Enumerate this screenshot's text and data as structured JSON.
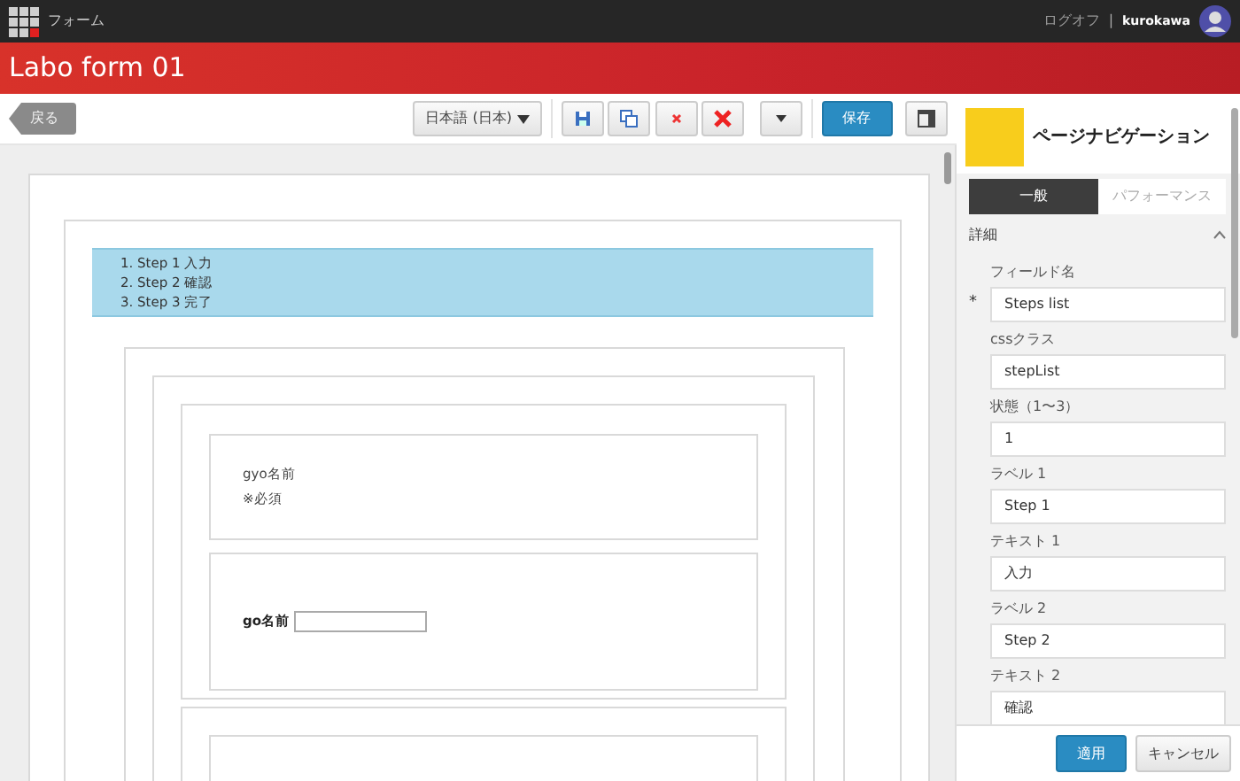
{
  "app": {
    "title": "フォーム",
    "logoff": "ログオフ",
    "separator": "|",
    "user": "kurokawa"
  },
  "header": {
    "title": "Labo form 01"
  },
  "toolbar": {
    "back": "戻る",
    "language": "日本語 (日本)",
    "save": "保存"
  },
  "canvas": {
    "steps": [
      "1. Step 1 入力",
      "2. Step 2 確認",
      "3. Step 3 完了"
    ],
    "cards": [
      {
        "kind": "text",
        "lines": [
          "gyo名前",
          "※必須"
        ]
      },
      {
        "kind": "input",
        "label": "go名前"
      },
      {
        "kind": "empty"
      }
    ]
  },
  "panel": {
    "title": "ページナビゲーション",
    "tabs": [
      {
        "label": "一般",
        "selected": true
      },
      {
        "label": "パフォーマンス",
        "selected": false
      }
    ],
    "section": {
      "title": "詳細",
      "expanded": true
    },
    "fields": [
      {
        "label": "フィールド名",
        "value": "Steps list",
        "required_mark": "*"
      },
      {
        "label": "cssクラス",
        "value": "stepList"
      },
      {
        "label": "状態（1〜3）",
        "value": "1"
      },
      {
        "label": "ラベル 1",
        "value": "Step 1"
      },
      {
        "label": "テキスト 1",
        "value": "入力"
      },
      {
        "label": "ラベル 2",
        "value": "Step 2"
      },
      {
        "label": "テキスト 2",
        "value": "確認"
      }
    ],
    "apply": "適用",
    "cancel": "キャンセル"
  }
}
